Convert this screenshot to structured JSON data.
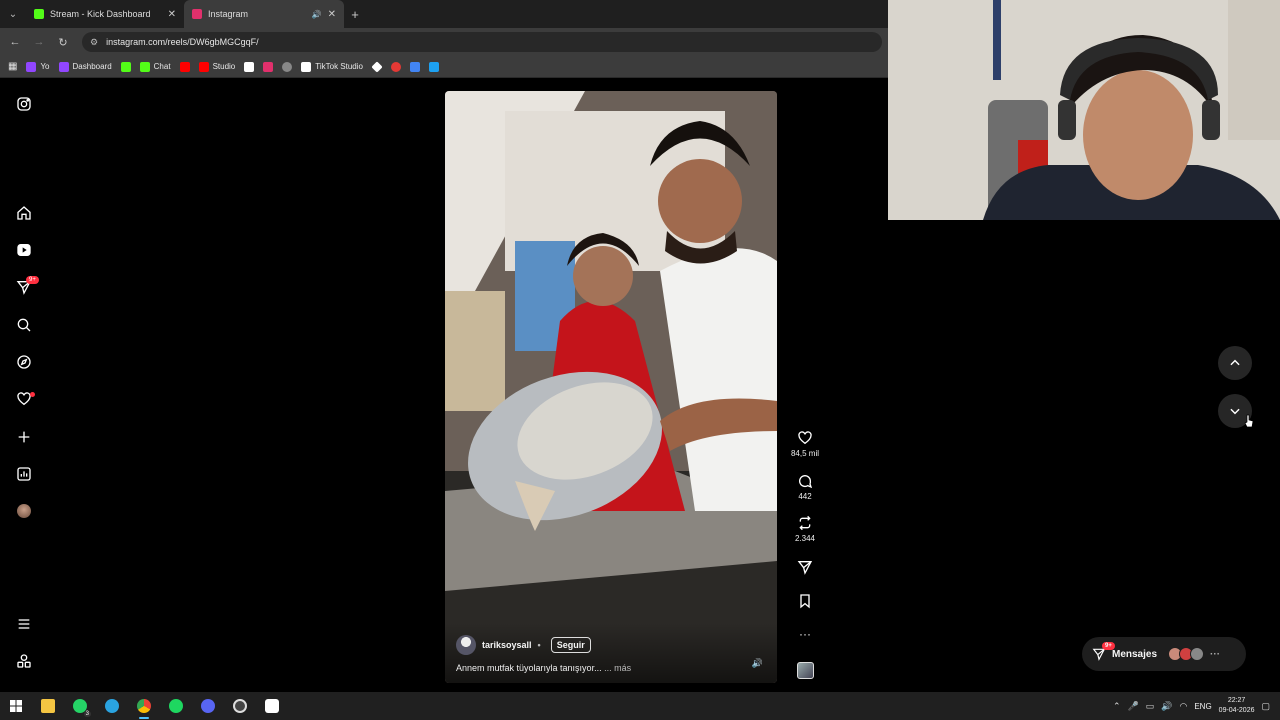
{
  "browser": {
    "tabs": [
      {
        "label": "Stream - Kick Dashboard",
        "favicon_color": "#53fc18",
        "active": false
      },
      {
        "label": "Instagram",
        "favicon_color": "#e1306c",
        "active": true
      }
    ],
    "url": "instagram.com/reels/DW6gbMGCgqF/",
    "bookmarks": [
      {
        "label": "Yo",
        "color": "#9146ff"
      },
      {
        "label": "Dashboard",
        "color": "#9146ff"
      },
      {
        "label": "",
        "color": "#53fc18"
      },
      {
        "label": "Chat",
        "color": "#53fc18"
      },
      {
        "label": "",
        "color": "#ff0000"
      },
      {
        "label": "Studio",
        "color": "#ff0000"
      },
      {
        "label": "",
        "color": "#ffffff"
      },
      {
        "label": "",
        "color": "#e1306c"
      },
      {
        "label": "",
        "color": "#888888"
      },
      {
        "label": "TikTok Studio",
        "color": "#ffffff"
      },
      {
        "label": "",
        "color": "#ffffff"
      },
      {
        "label": "",
        "color": "#e53935"
      },
      {
        "label": "",
        "color": "#4285f4"
      },
      {
        "label": "",
        "color": "#1da1f2"
      }
    ]
  },
  "sidebar": {
    "notifications_badge": "9+"
  },
  "reel": {
    "author": "tariksoysall",
    "follow_label": "Seguir",
    "caption": "Annem mutfak tüyolarıyla tanışıyor... ",
    "more_label": "... más",
    "likes": "84,5 mil",
    "comments": "442",
    "reposts": "2.344"
  },
  "messages": {
    "label": "Mensajes",
    "badge": "9+"
  },
  "taskbar": {
    "language": "ENG",
    "time": "22:27",
    "date": "09-04-2026",
    "whatsapp_badge": "3"
  }
}
